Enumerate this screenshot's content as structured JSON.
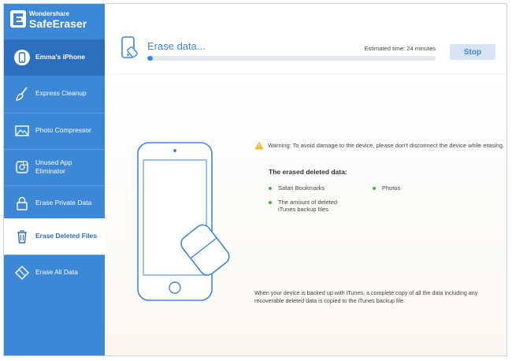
{
  "app": {
    "brand_small": "Wondershare",
    "brand_big": "SafeEraser",
    "accent_color": "#3c87d6",
    "sidebar_color": "#3c87d6",
    "active_color": "#2b6fbd",
    "success_color": "#3ab54a",
    "warning_color": "#f0b429"
  },
  "window_controls": {
    "feedback_icon": "feedback-icon",
    "menu_icon": "menu-icon",
    "minimize_label": "—",
    "close_label": "✕"
  },
  "sidebar": {
    "device": {
      "label": "Emma's iPhone",
      "icon": "iphone-icon"
    },
    "items": [
      {
        "label": "Express Cleanup",
        "icon": "broom-icon"
      },
      {
        "label": "Photo Compressor",
        "icon": "picture-icon"
      },
      {
        "label": "Unused App Eliminator",
        "icon": "app-icon"
      },
      {
        "label": "Erase Private Data",
        "icon": "lock-icon"
      },
      {
        "label": "Erase Deleted Files",
        "icon": "trash-icon",
        "active": true
      },
      {
        "label": "Erase All Data",
        "icon": "eraser-icon"
      }
    ]
  },
  "progress": {
    "title": "Erase data...",
    "estimate": "Estimated time: 24 minutes",
    "fraction": 0.02,
    "stop_label": "Stop"
  },
  "content": {
    "warning": "Warning: To avoid damage to the device, please don't disconnect the device while erasing.",
    "erased_title": "The erased deleted data:",
    "erased_items": [
      "Safari Bookmarks",
      "Photos",
      "The amount of deleted iTunes backup files"
    ],
    "footnote": "When your device is backed up with iTunes, a complete copy of all the data including any recoverable deleted data is copied to the iTunes backup file."
  }
}
